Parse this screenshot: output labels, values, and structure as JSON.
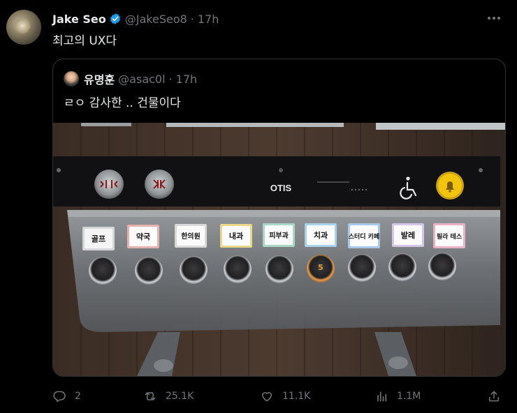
{
  "tweet": {
    "author_name": "Jake Seo",
    "author_handle": "@JakeSeo8",
    "separator": "·",
    "time": "17h",
    "text": "최고의 UX다"
  },
  "quote": {
    "author_name": "유명훈",
    "author_handle": "@asac0l",
    "separator": "·",
    "time": "17h",
    "text": "ㄹㅇ 감사한 .. 건물이다"
  },
  "photo": {
    "brand": "OTIS",
    "floor_labels": [
      "골프",
      "약국",
      "한의원",
      "내과",
      "피부과",
      "치과",
      "스터디 카페",
      "발레",
      "필라 테스"
    ],
    "label_colors": [
      "#f5f5f5",
      "#e9b7b7",
      "#f0f0f0",
      "#e8d88a",
      "#a8d8c4",
      "#a9d3ea",
      "#a8c8ea",
      "#d4c6e8",
      "#e9b3c5"
    ],
    "lit_button_number": "5",
    "alarm_color": "#f2c40a"
  },
  "actions": {
    "replies": "2",
    "retweets": "25.1K",
    "likes": "11.1K",
    "views": "1.1M"
  },
  "colors": {
    "background": "#000000",
    "text": "#e7e9ea",
    "muted": "#71767b",
    "border": "#2f3336",
    "verified": "#1d9bf0"
  }
}
